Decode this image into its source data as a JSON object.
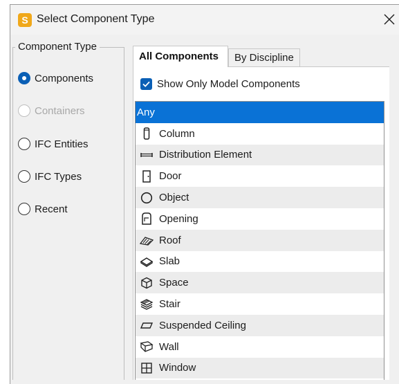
{
  "window": {
    "title": "Select Component Type",
    "app_icon_letter": "S"
  },
  "component_type": {
    "legend": "Component Type",
    "options": [
      {
        "label": "Components",
        "checked": true,
        "enabled": true
      },
      {
        "label": "Containers",
        "checked": false,
        "enabled": false
      },
      {
        "label": "IFC Entities",
        "checked": false,
        "enabled": true
      },
      {
        "label": "IFC Types",
        "checked": false,
        "enabled": true
      },
      {
        "label": "Recent",
        "checked": false,
        "enabled": true
      }
    ]
  },
  "tabs": [
    {
      "label": "All Components",
      "active": true
    },
    {
      "label": "By Discipline",
      "active": false
    }
  ],
  "filter": {
    "show_only_model_label": "Show Only Model Components",
    "checked": true
  },
  "list": {
    "items": [
      {
        "label": "Any",
        "icon": "none",
        "selected": true
      },
      {
        "label": "Column",
        "icon": "column-icon"
      },
      {
        "label": "Distribution Element",
        "icon": "distribution-element-icon"
      },
      {
        "label": "Door",
        "icon": "door-icon"
      },
      {
        "label": "Object",
        "icon": "object-icon"
      },
      {
        "label": "Opening",
        "icon": "opening-icon"
      },
      {
        "label": "Roof",
        "icon": "roof-icon"
      },
      {
        "label": "Slab",
        "icon": "slab-icon"
      },
      {
        "label": "Space",
        "icon": "space-icon"
      },
      {
        "label": "Stair",
        "icon": "stair-icon"
      },
      {
        "label": "Suspended Ceiling",
        "icon": "suspended-ceiling-icon"
      },
      {
        "label": "Wall",
        "icon": "wall-icon"
      },
      {
        "label": "Window",
        "icon": "window-icon"
      }
    ]
  },
  "colors": {
    "accent": "#0a5fb5",
    "selection": "#0a72d6",
    "app_icon": "#f0a81a"
  }
}
